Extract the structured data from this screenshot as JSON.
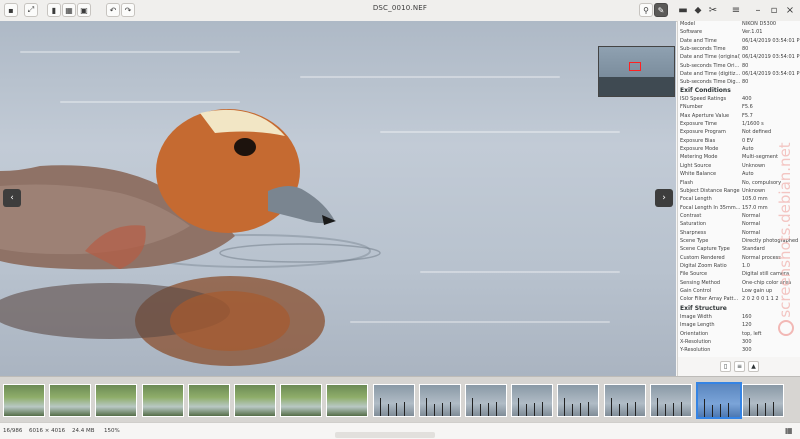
{
  "window": {
    "title": "DSC_0010.NEF",
    "minimize": "–",
    "maximize": "▫",
    "close": "×",
    "menu": "≡"
  },
  "toolbar": {
    "fullscreen": "⤢",
    "layout1": "▮",
    "layout2": "▦",
    "layout3": "▣",
    "rotate_left": "↶",
    "rotate_right": "↷",
    "pin": "⚲",
    "edit": "✎",
    "comments": "▬",
    "tags": "⬥",
    "tools": "✂"
  },
  "viewer": {
    "prev": "‹",
    "next": "›"
  },
  "exif": {
    "top_rows": [
      {
        "k": "Model",
        "v": "NIKON D5300"
      },
      {
        "k": "Software",
        "v": "Ver.1.01"
      },
      {
        "k": "Date and Time",
        "v": "06/14/2019 03:54:01 PM"
      },
      {
        "k": "Sub-seconds Time",
        "v": "80"
      },
      {
        "k": "Date and Time (original)",
        "v": "06/14/2019 03:54:01 PM"
      },
      {
        "k": "Sub-seconds Time Ori...",
        "v": "80"
      },
      {
        "k": "Date and Time (digitiz...",
        "v": "06/14/2019 03:54:01 PM"
      },
      {
        "k": "Sub-seconds Time Dig...",
        "v": "80"
      }
    ],
    "section_conditions": "Exif Conditions",
    "cond_rows": [
      {
        "k": "ISO Speed Ratings",
        "v": "400"
      },
      {
        "k": "FNumber",
        "v": "F5.6"
      },
      {
        "k": "Max Aperture Value",
        "v": "F5.7"
      },
      {
        "k": "Exposure Time",
        "v": "1/1600 s"
      },
      {
        "k": "Exposure Program",
        "v": "Not defined"
      },
      {
        "k": "Exposure Bias",
        "v": "0 EV"
      },
      {
        "k": "Exposure Mode",
        "v": "Auto"
      },
      {
        "k": "Metering Mode",
        "v": "Multi-segment"
      },
      {
        "k": "Light Source",
        "v": "Unknown"
      },
      {
        "k": "White Balance",
        "v": "Auto"
      },
      {
        "k": "Flash",
        "v": "No, compulsory"
      },
      {
        "k": "Subject Distance Range",
        "v": "Unknown"
      },
      {
        "k": "Focal Length",
        "v": "105.0 mm"
      },
      {
        "k": "Focal Length In 35mm...",
        "v": "157.0 mm"
      },
      {
        "k": "Contrast",
        "v": "Normal"
      },
      {
        "k": "Saturation",
        "v": "Normal"
      },
      {
        "k": "Sharpness",
        "v": "Normal"
      },
      {
        "k": "Scene Type",
        "v": "Directly photographed"
      },
      {
        "k": "Scene Capture Type",
        "v": "Standard"
      },
      {
        "k": "Custom Rendered",
        "v": "Normal process"
      },
      {
        "k": "Digital Zoom Ratio",
        "v": "1.0"
      },
      {
        "k": "File Source",
        "v": "Digital still camera"
      },
      {
        "k": "Sensing Method",
        "v": "One-chip color area"
      },
      {
        "k": "Gain Control",
        "v": "Low gain up"
      },
      {
        "k": "Color Filter Array Patt...",
        "v": "2 0 2 0 0 1 1 2"
      }
    ],
    "section_structure": "Exif Structure",
    "struct_rows": [
      {
        "k": "Image Width",
        "v": "160"
      },
      {
        "k": "Image Length",
        "v": "120"
      },
      {
        "k": "Orientation",
        "v": "top, left"
      },
      {
        "k": "X-Resolution",
        "v": "300"
      },
      {
        "k": "Y-Resolution",
        "v": "300"
      }
    ]
  },
  "status": {
    "position": "16/986",
    "dimensions": "6016 × 4016",
    "size": "24.4 MB",
    "zoom": "150%",
    "grid_icon": "▦"
  },
  "watermark": {
    "text": "screenshots.debian.net"
  },
  "colors": {
    "accent": "#3584e4",
    "duck_head": "#c7672e",
    "duck_body": "#8b6a5c"
  }
}
